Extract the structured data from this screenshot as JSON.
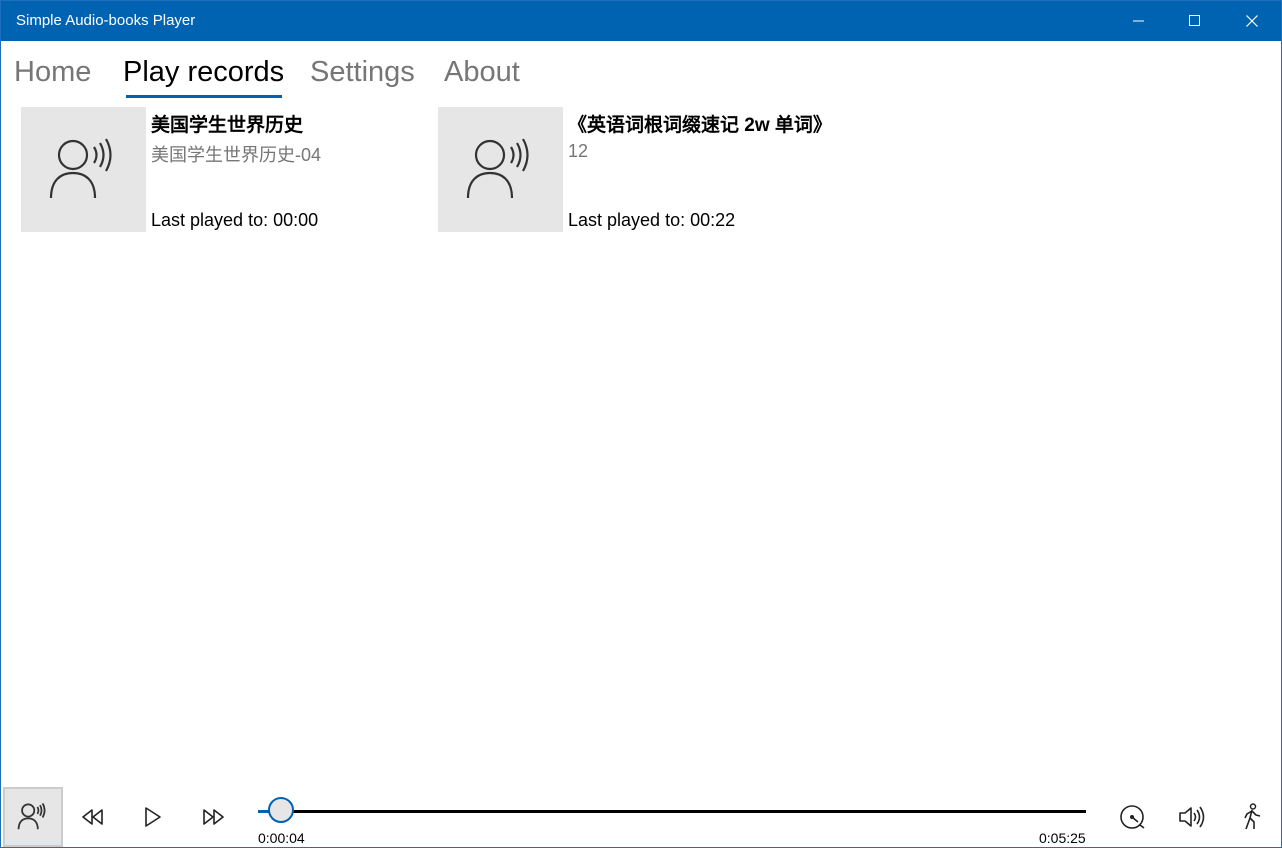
{
  "window": {
    "title": "Simple Audio-books Player"
  },
  "tabs": [
    {
      "label": "Home"
    },
    {
      "label": "Play records"
    },
    {
      "label": "Settings"
    },
    {
      "label": "About"
    }
  ],
  "active_tab": "Play records",
  "records": [
    {
      "title": "美国学生世界历史",
      "subtitle": "美国学生世界历史-04",
      "last_played": "Last played to: 00:00"
    },
    {
      "title": "《英语词根词缀速记 2w 单词》",
      "subtitle": "12",
      "last_played": "Last played to: 00:22"
    }
  ],
  "player": {
    "current_time": "0:00:04",
    "total_time": "0:05:25",
    "progress_fraction": 0.0123,
    "icons": [
      "audiobook-icon",
      "rewind-icon",
      "play-icon",
      "fast-forward-icon",
      "speed-icon",
      "volume-icon",
      "walk-mode-icon"
    ]
  },
  "colors": {
    "accent": "#0063b1",
    "thumb_bg": "#e6e6e6",
    "inactive_tab": "#767676"
  }
}
